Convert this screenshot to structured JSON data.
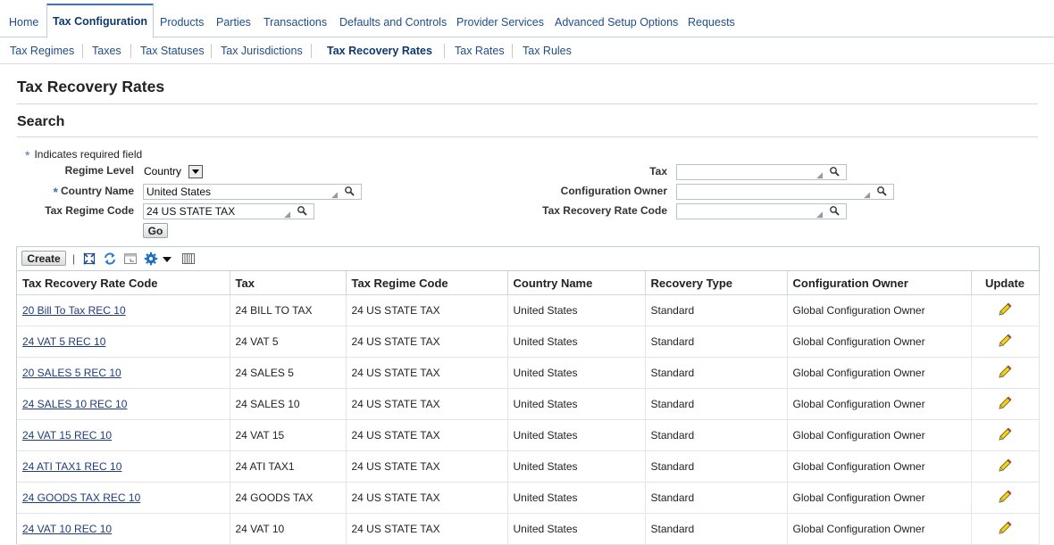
{
  "top_tabs": [
    "Home",
    "Tax Configuration",
    "Products",
    "Parties",
    "Transactions",
    "Defaults and Controls",
    "Provider Services",
    "Advanced Setup Options",
    "Requests"
  ],
  "sub_nav": [
    "Tax Regimes",
    "Taxes",
    "Tax Statuses",
    "Tax Jurisdictions",
    "Tax Recovery Rates",
    "Tax Rates",
    "Tax Rules"
  ],
  "page_title": "Tax Recovery Rates",
  "search": {
    "heading": "Search",
    "required_note": "Indicates required field",
    "required_star": "*",
    "regime_level_label": "Regime Level",
    "regime_level_value": "Country",
    "country_name_label": "Country Name",
    "country_name_value": "United States",
    "tax_regime_code_label": "Tax Regime Code",
    "tax_regime_code_value": "24 US STATE TAX",
    "tax_label": "Tax",
    "tax_value": "",
    "configuration_owner_label": "Configuration Owner",
    "configuration_owner_value": "",
    "tax_recovery_rate_code_label": "Tax Recovery Rate Code",
    "tax_recovery_rate_code_value": "",
    "go_label": "Go"
  },
  "toolbar": {
    "create_label": "Create",
    "separator": "|",
    "icons": [
      "detach-icon",
      "refresh-icon",
      "freeze-icon",
      "settings-icon",
      "columns-icon"
    ]
  },
  "table": {
    "columns": [
      "Tax Recovery Rate Code",
      "Tax",
      "Tax Regime Code",
      "Country Name",
      "Recovery Type",
      "Configuration Owner",
      "Update"
    ],
    "rows": [
      [
        "20 Bill To Tax REC 10",
        "24 BILL TO TAX",
        "24 US STATE TAX",
        "United States",
        "Standard",
        "Global Configuration Owner"
      ],
      [
        "24 VAT 5 REC 10",
        "24 VAT 5",
        "24 US STATE TAX",
        "United States",
        "Standard",
        "Global Configuration Owner"
      ],
      [
        "20 SALES 5 REC 10",
        "24 SALES 5",
        "24 US STATE TAX",
        "United States",
        "Standard",
        "Global Configuration Owner"
      ],
      [
        "24 SALES 10 REC 10",
        "24 SALES 10",
        "24 US STATE TAX",
        "United States",
        "Standard",
        "Global Configuration Owner"
      ],
      [
        "24 VAT 15 REC 10",
        "24 VAT 15",
        "24 US STATE TAX",
        "United States",
        "Standard",
        "Global Configuration Owner"
      ],
      [
        "24 ATI TAX1 REC 10",
        "24 ATI TAX1",
        "24 US STATE TAX",
        "United States",
        "Standard",
        "Global Configuration Owner"
      ],
      [
        "24 GOODS TAX REC 10",
        "24 GOODS TAX",
        "24 US STATE TAX",
        "United States",
        "Standard",
        "Global Configuration Owner"
      ],
      [
        "24 VAT 10 REC 10",
        "24 VAT 10",
        "24 US STATE TAX",
        "United States",
        "Standard",
        "Global Configuration Owner"
      ]
    ]
  },
  "colors": {
    "link": "#1f4d8a",
    "accent": "#3b73b9",
    "border": "#c4cdd6"
  }
}
